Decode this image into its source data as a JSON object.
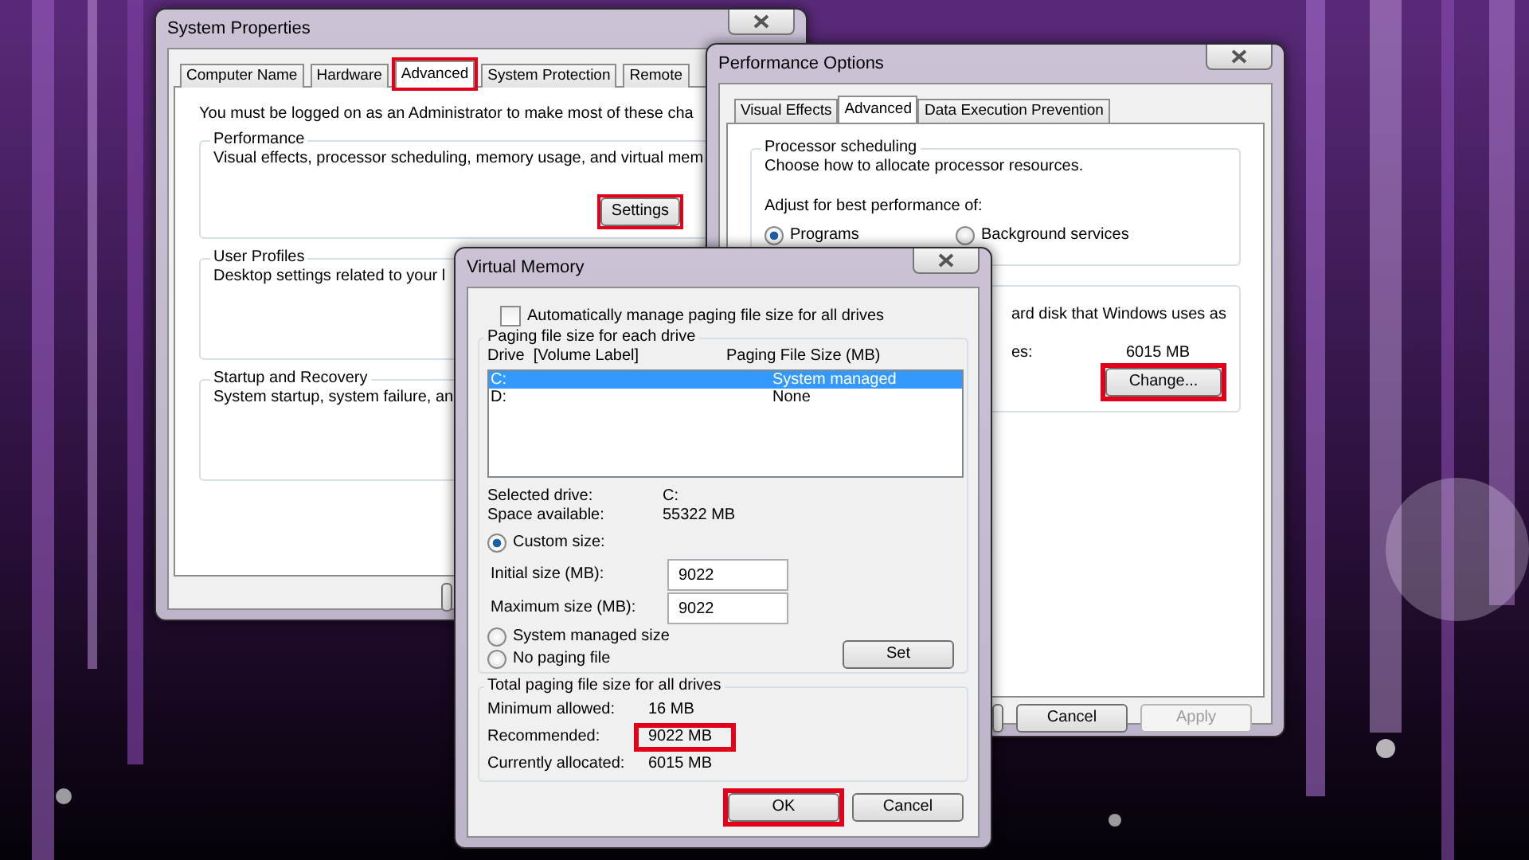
{
  "system_properties": {
    "title": "System Properties",
    "tabs": [
      {
        "label": "Computer Name",
        "selected": false,
        "highlighted": false
      },
      {
        "label": "Hardware",
        "selected": false,
        "highlighted": false
      },
      {
        "label": "Advanced",
        "selected": true,
        "highlighted": true
      },
      {
        "label": "System Protection",
        "selected": false,
        "highlighted": false
      },
      {
        "label": "Remote",
        "selected": false,
        "highlighted": false
      }
    ],
    "notice": "You must be logged on as an Administrator to make most of these cha",
    "groups": [
      {
        "title": "Performance",
        "text": "Visual effects, processor scheduling, memory usage, and virtual mem",
        "button": {
          "label": "Settings",
          "highlighted": true
        }
      },
      {
        "title": "User Profiles",
        "text": "Desktop settings related to your l"
      },
      {
        "title": "Startup and Recovery",
        "text": "System startup, system failure, an"
      }
    ]
  },
  "performance_options": {
    "title": "Performance Options",
    "tabs": [
      {
        "label": "Visual Effects",
        "selected": false
      },
      {
        "label": "Advanced",
        "selected": true
      },
      {
        "label": "Data Execution Prevention",
        "selected": false
      }
    ],
    "processor_scheduling": {
      "title": "Processor scheduling",
      "text": "Choose how to allocate processor resources.",
      "adjust_label": "Adjust for best performance of:",
      "options": [
        {
          "label": "Programs",
          "selected": true
        },
        {
          "label": "Background services",
          "selected": false
        }
      ]
    },
    "virtual_memory": {
      "text": "ard disk that Windows uses as",
      "label": "es:",
      "value": "6015 MB",
      "button": {
        "label": "Change...",
        "highlighted": true
      }
    },
    "buttons": [
      {
        "label": "Cancel",
        "disabled": false
      },
      {
        "label": "Apply",
        "disabled": true
      }
    ]
  },
  "virtual_memory": {
    "title": "Virtual Memory",
    "auto_manage": {
      "label": "Automatically manage paging file size for all drives",
      "checked": false
    },
    "drives_group": "Paging file size for each drive",
    "columns": [
      "Drive  [Volume Label]",
      "Paging File Size (MB)"
    ],
    "drives": [
      {
        "drive": "C:",
        "size": "System managed",
        "selected": true
      },
      {
        "drive": "D:",
        "size": "None",
        "selected": false
      }
    ],
    "info": [
      {
        "label": "Selected drive:",
        "value": "C:"
      },
      {
        "label": "Space available:",
        "value": "55322 MB"
      }
    ],
    "custom_size": {
      "label": "Custom size:",
      "selected": true,
      "fields": [
        {
          "label": "Initial size (MB):",
          "value": "9022"
        },
        {
          "label": "Maximum size (MB):",
          "value": "9022"
        }
      ]
    },
    "other_options": [
      {
        "label": "System managed size",
        "selected": false
      },
      {
        "label": "No paging file",
        "selected": false
      }
    ],
    "set_button": "Set",
    "totals": {
      "title": "Total paging file size for all drives",
      "rows": [
        {
          "label": "Minimum allowed:",
          "value": "16 MB",
          "highlighted": false
        },
        {
          "label": "Recommended:",
          "value": "9022 MB",
          "highlighted": true
        },
        {
          "label": "Currently allocated:",
          "value": "6015 MB",
          "highlighted": false
        }
      ]
    },
    "buttons": [
      {
        "label": "OK",
        "highlighted": true
      },
      {
        "label": "Cancel",
        "highlighted": false
      }
    ]
  }
}
